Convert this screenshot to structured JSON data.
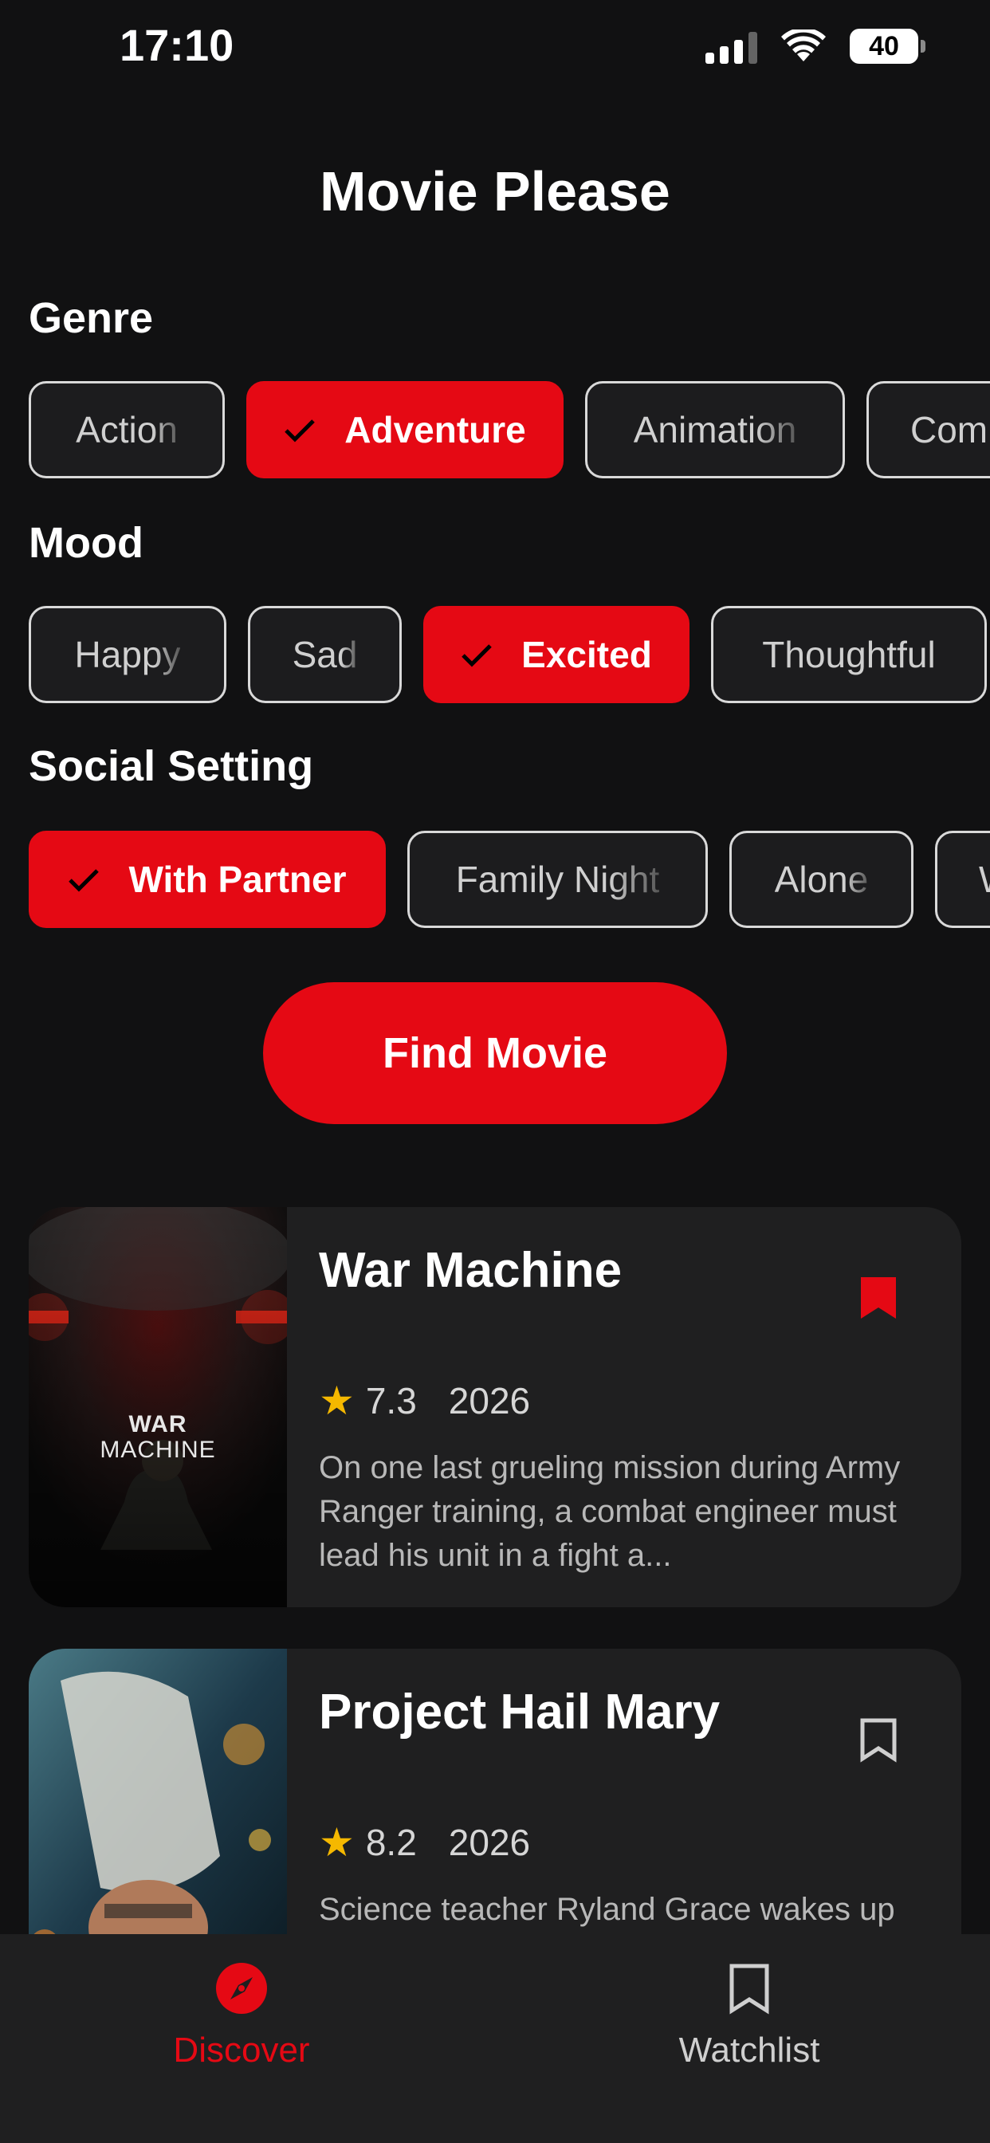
{
  "status_bar": {
    "time": "17:10",
    "battery": "40"
  },
  "app_title": "Movie Please",
  "sections": {
    "genre": {
      "label": "Genre",
      "chips": [
        {
          "label": "Action",
          "selected": false
        },
        {
          "label": "Adventure",
          "selected": true
        },
        {
          "label": "Animation",
          "selected": false
        },
        {
          "label": "Com",
          "selected": false
        }
      ]
    },
    "mood": {
      "label": "Mood",
      "chips": [
        {
          "label": "Happy",
          "selected": false
        },
        {
          "label": "Sad",
          "selected": false
        },
        {
          "label": "Excited",
          "selected": true
        },
        {
          "label": "Thoughtful",
          "selected": false
        }
      ]
    },
    "social": {
      "label": "Social Setting",
      "chips": [
        {
          "label": "With Partner",
          "selected": true
        },
        {
          "label": "Family Night",
          "selected": false
        },
        {
          "label": "Alone",
          "selected": false
        },
        {
          "label": "W",
          "selected": false
        }
      ]
    }
  },
  "find_button": "Find Movie",
  "movies": [
    {
      "title": "War Machine",
      "poster_text_1": "WAR",
      "poster_text_2": "MACHINE",
      "rating": "7.3",
      "year": "2026",
      "description": "On one last grueling mission during Army Ranger training, a combat engineer must lead his unit in a fight a...",
      "bookmarked": true
    },
    {
      "title": "Project Hail Mary",
      "rating": "8.2",
      "year": "2026",
      "description": "Science teacher Ryland Grace wakes up",
      "bookmarked": false
    }
  ],
  "nav": {
    "discover": "Discover",
    "watchlist": "Watchlist",
    "active_color": "#e50914",
    "inactive_color": "#cfcfcf"
  },
  "colors": {
    "accent": "#e50914",
    "star": "#f5b800",
    "background": "#111112",
    "card": "#1f1f20"
  }
}
